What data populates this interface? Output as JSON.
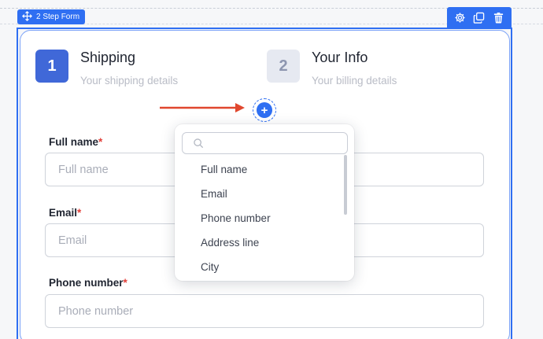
{
  "block": {
    "label": "2 Step Form",
    "icon": "move-icon"
  },
  "toolbar": {
    "icons": [
      "gear-icon",
      "duplicate-icon",
      "trash-icon"
    ]
  },
  "steps": [
    {
      "number": "1",
      "title": "Shipping",
      "subtitle": "Your shipping details",
      "active": true
    },
    {
      "number": "2",
      "title": "Your Info",
      "subtitle": "Your billing details",
      "active": false
    }
  ],
  "add_button": {
    "symbol": "+",
    "icon": "plus-icon"
  },
  "annotation": {
    "icon": "red-arrow-icon",
    "color": "#e0472e"
  },
  "fields": [
    {
      "label": "Full name",
      "required_mark": "*",
      "placeholder": "Full name"
    },
    {
      "label": "Email",
      "required_mark": "*",
      "placeholder": "Email"
    },
    {
      "label": "Phone number",
      "required_mark": "*",
      "placeholder": "Phone number"
    }
  ],
  "dropdown": {
    "search_value": "",
    "search_icon": "search-icon",
    "items": [
      "Full name",
      "Email",
      "Phone number",
      "Address line",
      "City"
    ]
  },
  "colors": {
    "accent": "#2f6ff2",
    "step_active": "#4068d8",
    "required": "#e2403a"
  }
}
